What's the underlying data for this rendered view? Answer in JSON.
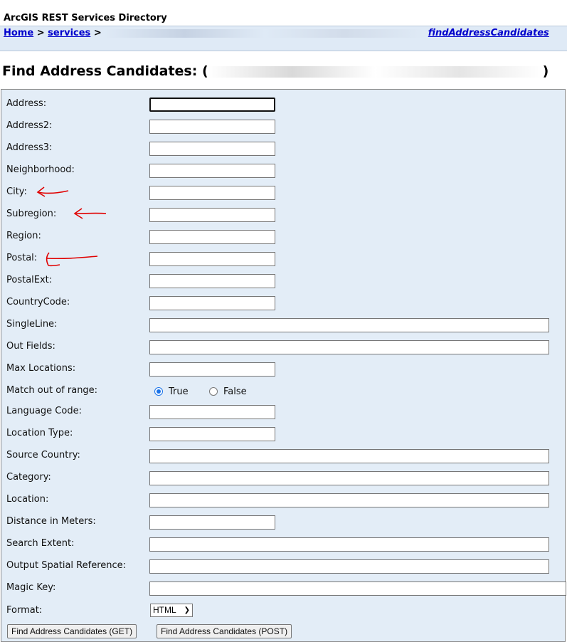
{
  "header": {
    "title": "ArcGIS REST Services Directory"
  },
  "breadcrumb": {
    "home": "Home",
    "sep1": " > ",
    "services": "services",
    "sep2": " > ",
    "current": "findAddressCandidates"
  },
  "page": {
    "title": "Find Address Candidates: ("
  },
  "form": {
    "address_label": "Address:",
    "address2_label": "Address2:",
    "address3_label": "Address3:",
    "neighborhood_label": "Neighborhood:",
    "city_label": "City:",
    "subregion_label": "Subregion:",
    "region_label": "Region:",
    "postal_label": "Postal:",
    "postalext_label": "PostalExt:",
    "countrycode_label": "CountryCode:",
    "singleline_label": "SingleLine:",
    "outfields_label": "Out Fields:",
    "maxlocations_label": "Max Locations:",
    "matchoutofrange_label": "Match out of range:",
    "true_label": "True",
    "false_label": "False",
    "matchoutofrange_value": "True",
    "languagecode_label": "Language Code:",
    "locationtype_label": "Location Type:",
    "sourcecountry_label": "Source Country:",
    "category_label": "Category:",
    "location_label": "Location:",
    "distance_label": "Distance in Meters:",
    "searchextent_label": "Search Extent:",
    "outsr_label": "Output Spatial Reference:",
    "magickey_label": "Magic Key:",
    "format_label": "Format:",
    "format_value": "HTML",
    "get_button": "Find Address Candidates (GET)",
    "post_button": "Find Address Candidates (POST)"
  },
  "icons": {
    "dropdown": "chevron-down-icon",
    "annotation": "red-arrow-annotation"
  },
  "colors": {
    "panel_bg": "#e3edf7",
    "link": "#0000cc",
    "visited_link": "#551a8b",
    "annotation": "#e00000",
    "radio_checked": "#1a73e8"
  }
}
